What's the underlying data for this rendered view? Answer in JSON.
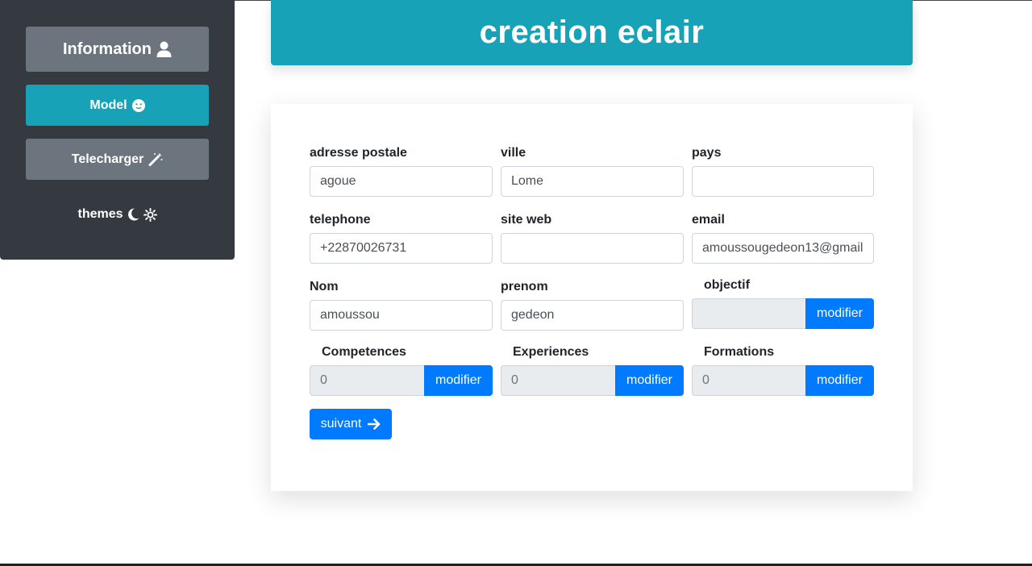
{
  "sidebar": {
    "info_label": "Information",
    "model_label": "Model",
    "download_label": "Telecharger",
    "themes_label": "themes"
  },
  "header": {
    "title": "creation eclair"
  },
  "form": {
    "adresse": {
      "label": "adresse postale",
      "value": "agoue"
    },
    "ville": {
      "label": "ville",
      "value": "Lome"
    },
    "pays": {
      "label": "pays",
      "value": ""
    },
    "telephone": {
      "label": "telephone",
      "value": "+22870026731"
    },
    "site": {
      "label": "site web",
      "value": ""
    },
    "email": {
      "label": "email",
      "value": "amoussougedeon13@gmail."
    },
    "nom": {
      "label": "Nom",
      "value": "amoussou"
    },
    "prenom": {
      "label": "prenom",
      "value": "gedeon"
    },
    "objectif": {
      "label": "objectif",
      "value": "",
      "button": "modifier"
    },
    "competences": {
      "label": "Competences",
      "value": "0",
      "button": "modifier"
    },
    "experiences": {
      "label": "Experiences",
      "value": "0",
      "button": "modifier"
    },
    "formations": {
      "label": "Formations",
      "value": "0",
      "button": "modifier"
    },
    "next_label": "suivant"
  },
  "colors": {
    "sidebar_bg": "#343a40",
    "secondary": "#6c757d",
    "info": "#17a2b8",
    "primary": "#007bff"
  },
  "icons": {
    "information": "user-icon",
    "model": "smile-icon",
    "telecharger": "magic-wand-icon",
    "themes_dark": "moon-icon",
    "themes_light": "sun-icon",
    "suivant": "arrow-right-icon"
  }
}
